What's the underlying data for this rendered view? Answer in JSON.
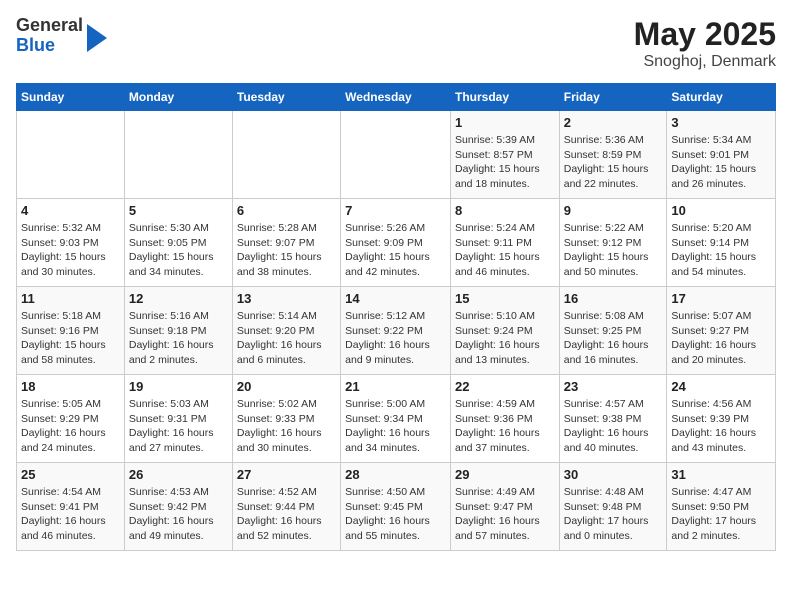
{
  "header": {
    "logo": {
      "line1": "General",
      "line2": "Blue"
    },
    "title": "May 2025",
    "subtitle": "Snoghoj, Denmark"
  },
  "weekdays": [
    "Sunday",
    "Monday",
    "Tuesday",
    "Wednesday",
    "Thursday",
    "Friday",
    "Saturday"
  ],
  "weeks": [
    [
      {
        "day": "",
        "info": ""
      },
      {
        "day": "",
        "info": ""
      },
      {
        "day": "",
        "info": ""
      },
      {
        "day": "",
        "info": ""
      },
      {
        "day": "1",
        "info": "Sunrise: 5:39 AM\nSunset: 8:57 PM\nDaylight: 15 hours\nand 18 minutes."
      },
      {
        "day": "2",
        "info": "Sunrise: 5:36 AM\nSunset: 8:59 PM\nDaylight: 15 hours\nand 22 minutes."
      },
      {
        "day": "3",
        "info": "Sunrise: 5:34 AM\nSunset: 9:01 PM\nDaylight: 15 hours\nand 26 minutes."
      }
    ],
    [
      {
        "day": "4",
        "info": "Sunrise: 5:32 AM\nSunset: 9:03 PM\nDaylight: 15 hours\nand 30 minutes."
      },
      {
        "day": "5",
        "info": "Sunrise: 5:30 AM\nSunset: 9:05 PM\nDaylight: 15 hours\nand 34 minutes."
      },
      {
        "day": "6",
        "info": "Sunrise: 5:28 AM\nSunset: 9:07 PM\nDaylight: 15 hours\nand 38 minutes."
      },
      {
        "day": "7",
        "info": "Sunrise: 5:26 AM\nSunset: 9:09 PM\nDaylight: 15 hours\nand 42 minutes."
      },
      {
        "day": "8",
        "info": "Sunrise: 5:24 AM\nSunset: 9:11 PM\nDaylight: 15 hours\nand 46 minutes."
      },
      {
        "day": "9",
        "info": "Sunrise: 5:22 AM\nSunset: 9:12 PM\nDaylight: 15 hours\nand 50 minutes."
      },
      {
        "day": "10",
        "info": "Sunrise: 5:20 AM\nSunset: 9:14 PM\nDaylight: 15 hours\nand 54 minutes."
      }
    ],
    [
      {
        "day": "11",
        "info": "Sunrise: 5:18 AM\nSunset: 9:16 PM\nDaylight: 15 hours\nand 58 minutes."
      },
      {
        "day": "12",
        "info": "Sunrise: 5:16 AM\nSunset: 9:18 PM\nDaylight: 16 hours\nand 2 minutes."
      },
      {
        "day": "13",
        "info": "Sunrise: 5:14 AM\nSunset: 9:20 PM\nDaylight: 16 hours\nand 6 minutes."
      },
      {
        "day": "14",
        "info": "Sunrise: 5:12 AM\nSunset: 9:22 PM\nDaylight: 16 hours\nand 9 minutes."
      },
      {
        "day": "15",
        "info": "Sunrise: 5:10 AM\nSunset: 9:24 PM\nDaylight: 16 hours\nand 13 minutes."
      },
      {
        "day": "16",
        "info": "Sunrise: 5:08 AM\nSunset: 9:25 PM\nDaylight: 16 hours\nand 16 minutes."
      },
      {
        "day": "17",
        "info": "Sunrise: 5:07 AM\nSunset: 9:27 PM\nDaylight: 16 hours\nand 20 minutes."
      }
    ],
    [
      {
        "day": "18",
        "info": "Sunrise: 5:05 AM\nSunset: 9:29 PM\nDaylight: 16 hours\nand 24 minutes."
      },
      {
        "day": "19",
        "info": "Sunrise: 5:03 AM\nSunset: 9:31 PM\nDaylight: 16 hours\nand 27 minutes."
      },
      {
        "day": "20",
        "info": "Sunrise: 5:02 AM\nSunset: 9:33 PM\nDaylight: 16 hours\nand 30 minutes."
      },
      {
        "day": "21",
        "info": "Sunrise: 5:00 AM\nSunset: 9:34 PM\nDaylight: 16 hours\nand 34 minutes."
      },
      {
        "day": "22",
        "info": "Sunrise: 4:59 AM\nSunset: 9:36 PM\nDaylight: 16 hours\nand 37 minutes."
      },
      {
        "day": "23",
        "info": "Sunrise: 4:57 AM\nSunset: 9:38 PM\nDaylight: 16 hours\nand 40 minutes."
      },
      {
        "day": "24",
        "info": "Sunrise: 4:56 AM\nSunset: 9:39 PM\nDaylight: 16 hours\nand 43 minutes."
      }
    ],
    [
      {
        "day": "25",
        "info": "Sunrise: 4:54 AM\nSunset: 9:41 PM\nDaylight: 16 hours\nand 46 minutes."
      },
      {
        "day": "26",
        "info": "Sunrise: 4:53 AM\nSunset: 9:42 PM\nDaylight: 16 hours\nand 49 minutes."
      },
      {
        "day": "27",
        "info": "Sunrise: 4:52 AM\nSunset: 9:44 PM\nDaylight: 16 hours\nand 52 minutes."
      },
      {
        "day": "28",
        "info": "Sunrise: 4:50 AM\nSunset: 9:45 PM\nDaylight: 16 hours\nand 55 minutes."
      },
      {
        "day": "29",
        "info": "Sunrise: 4:49 AM\nSunset: 9:47 PM\nDaylight: 16 hours\nand 57 minutes."
      },
      {
        "day": "30",
        "info": "Sunrise: 4:48 AM\nSunset: 9:48 PM\nDaylight: 17 hours\nand 0 minutes."
      },
      {
        "day": "31",
        "info": "Sunrise: 4:47 AM\nSunset: 9:50 PM\nDaylight: 17 hours\nand 2 minutes."
      }
    ]
  ]
}
